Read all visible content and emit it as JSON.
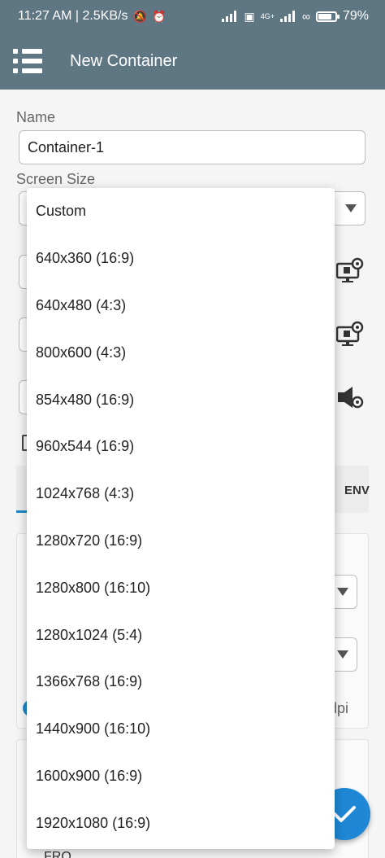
{
  "status_bar": {
    "time_speed": "11:27 AM | 2.5KB/s",
    "network_label": "4G+",
    "battery_percent": "79%",
    "battery_level": 0.79
  },
  "app_bar": {
    "title": "New Container"
  },
  "form": {
    "name_label": "Name",
    "name_value": "Container-1",
    "screen_size_label": "Screen Size",
    "tab_env_label": "ENV",
    "dpi_suffix": "dpi",
    "bottom_select_value": "FRO"
  },
  "dropdown": {
    "options": [
      "Custom",
      "640x360 (16:9)",
      "640x480 (4:3)",
      "800x600 (4:3)",
      "854x480 (16:9)",
      "960x544 (16:9)",
      "1024x768 (4:3)",
      "1280x720 (16:9)",
      "1280x800 (16:10)",
      "1280x1024 (5:4)",
      "1366x768 (16:9)",
      "1440x900 (16:10)",
      "1600x900 (16:9)",
      "1920x1080 (16:9)"
    ]
  },
  "icons": {
    "menu": "menu-icon",
    "check": "check-icon",
    "gear": "monitor-gear-icon",
    "speaker": "speaker-gear-icon"
  },
  "colors": {
    "app_bar": "#5f7683",
    "accent": "#1e88d6"
  }
}
